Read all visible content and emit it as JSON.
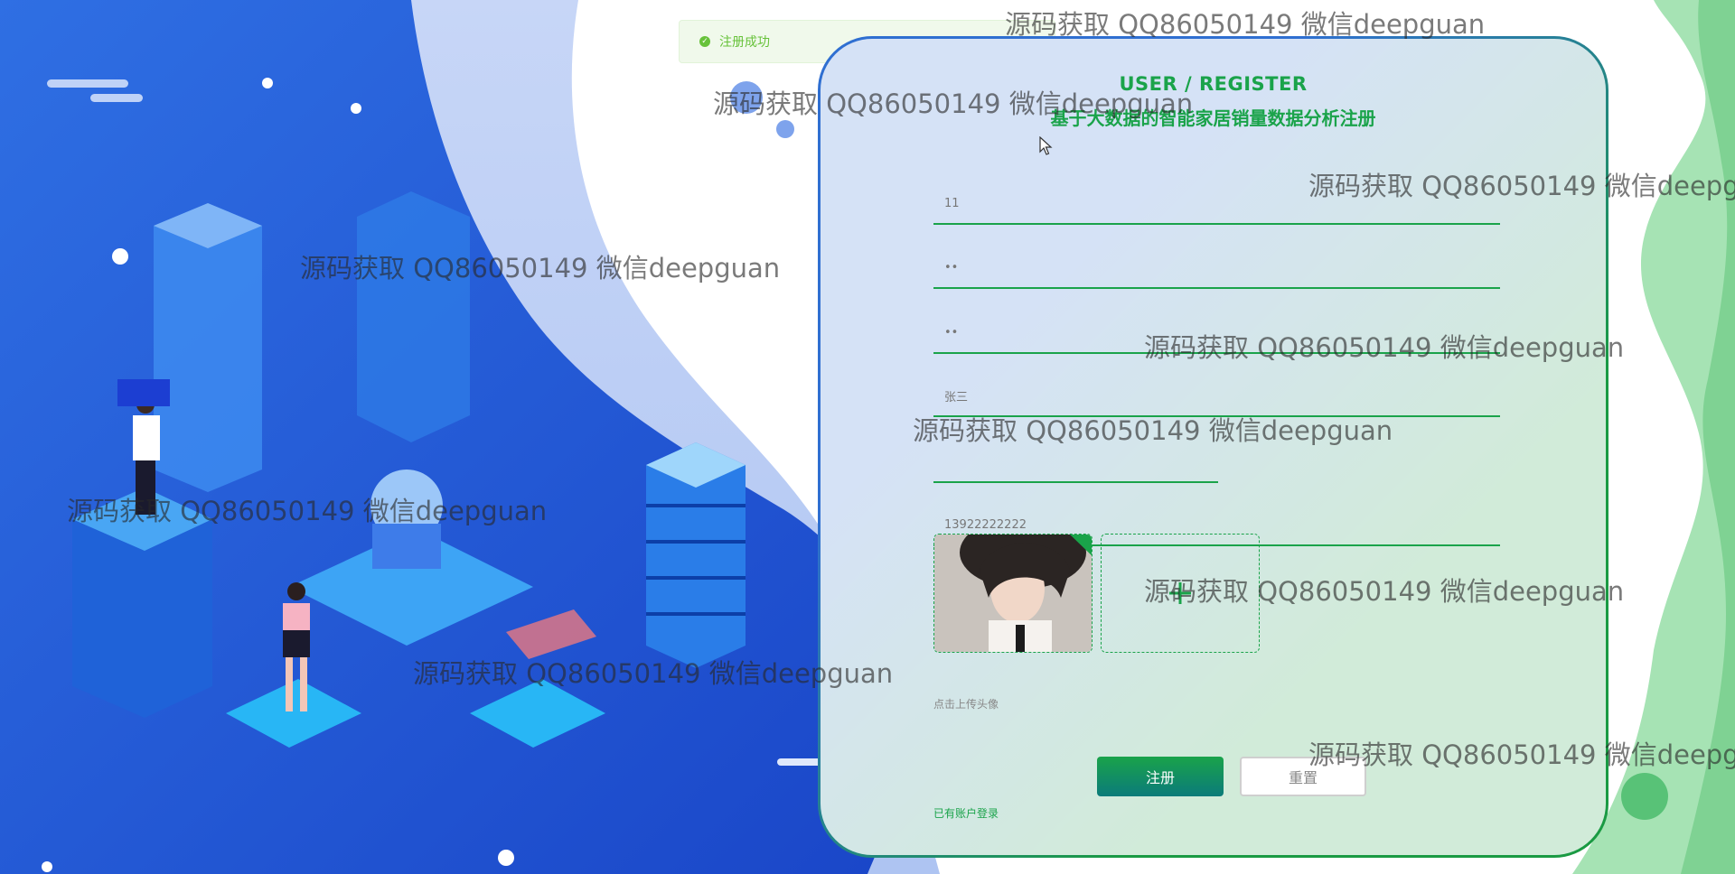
{
  "toast": {
    "message": "注册成功",
    "icon": "check-circle-icon"
  },
  "header": {
    "title_en": "USER / REGISTER",
    "title_cn": "基于大数据的智能家居销量数据分析注册"
  },
  "form": {
    "account": "11",
    "password": "••",
    "confirm_password": "••",
    "name": "张三",
    "gender": "",
    "phone": "13922222222",
    "upload_hint": "点击上传头像",
    "upload_add_icon": "plus-icon"
  },
  "buttons": {
    "submit": "注册",
    "reset": "重置"
  },
  "links": {
    "login": "已有账户登录"
  },
  "watermark": "源码获取 QQ86050149 微信deepguan",
  "colors": {
    "accent": "#1aa34a",
    "bg_blue": "#2f6fd1",
    "toast_green": "#67c23a"
  }
}
